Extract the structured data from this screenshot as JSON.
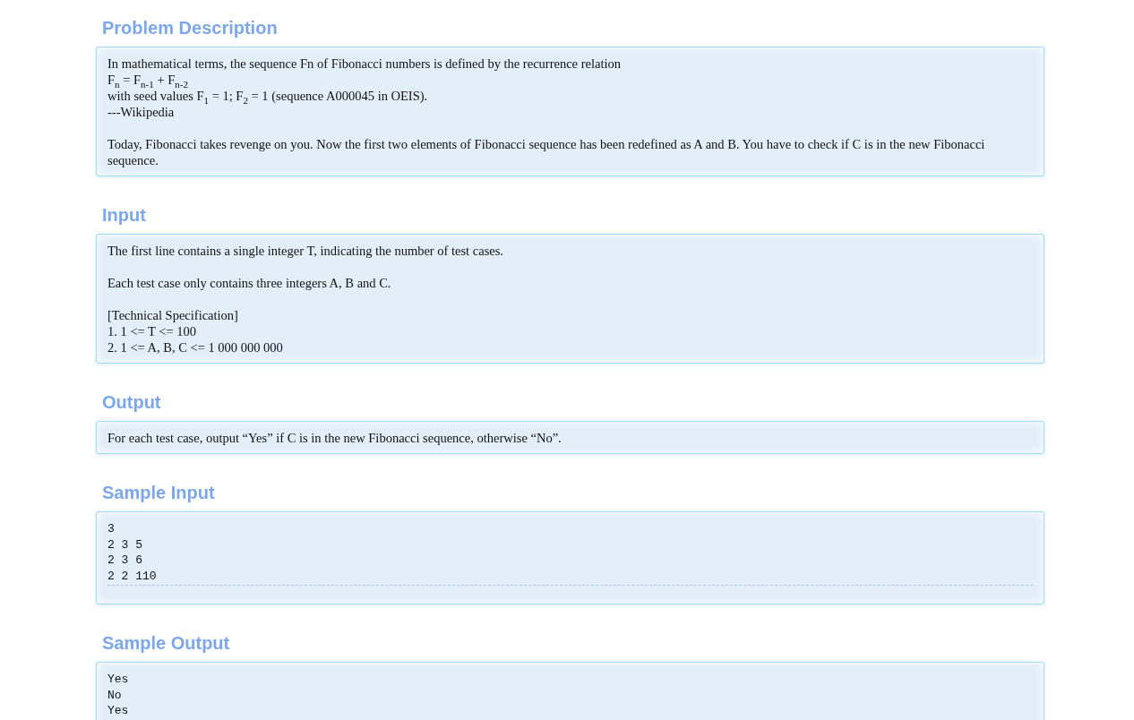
{
  "sections": [
    {
      "title": "Problem Description",
      "kind": "text",
      "paragraphs": [
        [
          "In mathematical terms, the sequence Fn of Fibonacci numbers is defined by the recurrence relation",
          "F$_{n}$ = F$_{n-1}$ + F$_{n-2}$",
          "with seed values F$_{1}$ = 1; F$_{2}$ = 1 (sequence A000045 in OEIS).",
          "---Wikipedia"
        ],
        [
          "Today, Fibonacci takes revenge on you. Now the first two elements of Fibonacci sequence has been redefined as A and B. You have to check if C is in the new Fibonacci sequence."
        ]
      ]
    },
    {
      "title": "Input",
      "kind": "text",
      "paragraphs": [
        [
          "The first line contains a single integer T, indicating the number of test cases."
        ],
        [
          "Each test case only contains three integers A, B and C."
        ],
        [
          "[Technical Specification]",
          "1. 1 <= T <= 100",
          "2. 1 <= A, B, C <= 1 000 000 000"
        ]
      ]
    },
    {
      "title": "Output",
      "kind": "text",
      "paragraphs": [
        [
          "For each test case, output “Yes” if C is in the new Fibonacci sequence, otherwise “No”."
        ]
      ]
    },
    {
      "title": "Sample Input",
      "kind": "code",
      "paragraphs": [
        [
          "3",
          "2 3 5",
          "2 3 6",
          "2 2 110"
        ]
      ]
    },
    {
      "title": "Sample Output",
      "kind": "code",
      "paragraphs": [
        [
          "Yes",
          "No",
          "Yes"
        ]
      ]
    }
  ]
}
